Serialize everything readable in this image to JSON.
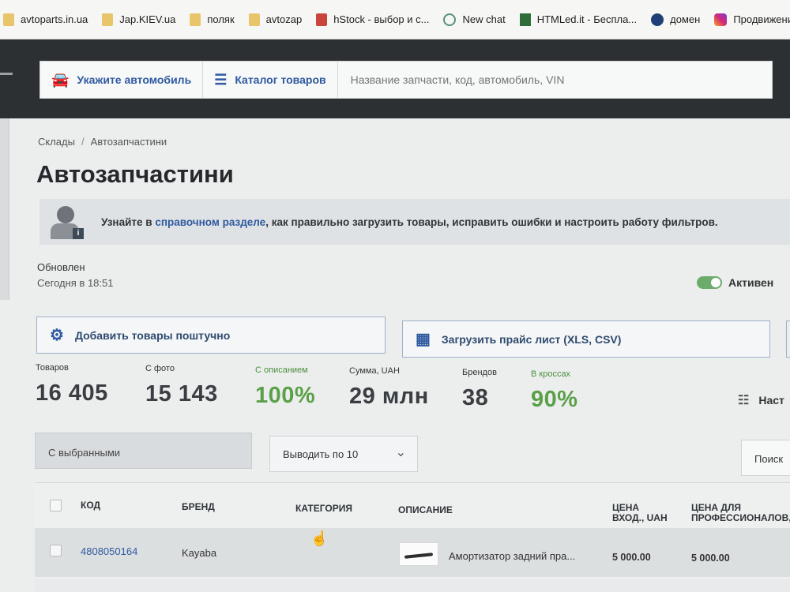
{
  "bookmarks": [
    {
      "label": "avtoparts.in.ua",
      "icon": "folder-icon"
    },
    {
      "label": "Jap.KIEV.ua",
      "icon": "folder-icon"
    },
    {
      "label": "поляк",
      "icon": "folder-icon"
    },
    {
      "label": "avtozap",
      "icon": "folder-icon"
    },
    {
      "label": "hStock - выбор и с...",
      "icon": "cart-icon"
    },
    {
      "label": "New chat",
      "icon": "chatgpt-icon"
    },
    {
      "label": "HTMLed.it - Беспла...",
      "icon": "htmled-icon"
    },
    {
      "label": "домен",
      "icon": "globe-icon"
    },
    {
      "label": "Продвижение",
      "icon": "instagram-icon"
    }
  ],
  "header": {
    "car_button": "Укажите автомобиль",
    "catalog_button": "Каталог товаров",
    "search_placeholder": "Название запчасти, код, автомобиль, VIN"
  },
  "breadcrumb": {
    "parent": "Склады",
    "separator": "/",
    "current": "Автозапчастини"
  },
  "page_title": "Автозапчастини",
  "help": {
    "prefix": "Узнайте в ",
    "link": "справочном разделе",
    "suffix": ", как правильно загрузить товары, исправить ошибки и настроить работу фильтров."
  },
  "status": {
    "updated_label": "Обновлен",
    "updated_value": "Сегодня в 18:51",
    "active_label": "Активен",
    "active": true
  },
  "actions": {
    "add_items": "Добавить товары поштучно",
    "upload_price": "Загрузить прайс лист (XLS, CSV)"
  },
  "stats": [
    {
      "label": "Товаров",
      "value": "16 405"
    },
    {
      "label": "С фото",
      "value": "15 143"
    },
    {
      "label": "С описанием",
      "value": "100%"
    },
    {
      "label": "Сумма, UAH",
      "value": "29 млн"
    },
    {
      "label": "Брендов",
      "value": "38"
    },
    {
      "label": "В кроссах",
      "value": "90%"
    }
  ],
  "settings_label": "Наст",
  "toolbar": {
    "bulk_label": "С выбранными",
    "per_page": "Выводить по 10",
    "search_button": "Поиск"
  },
  "table": {
    "headers": {
      "code": "КОД",
      "brand": "БРЕНД",
      "category": "КАТЕГОРИЯ",
      "description": "ОПИСАНИЕ",
      "price_in_1": "ЦЕНА",
      "price_in_2": "ВХОД., UAH",
      "price_pro_1": "ЦЕНА  ДЛЯ",
      "price_pro_2": "ПРОФЕССИОНАЛОВ,"
    },
    "rows": [
      {
        "code": "4808050164",
        "brand": "Kayaba",
        "category": "",
        "description": "Амортизатор задний пра...",
        "price_in": "5 000.00",
        "price_pro": "5 000.00"
      }
    ]
  },
  "colors": {
    "header_bg": "#2d3033",
    "link_blue": "#2f5aa0",
    "accent_green": "#5aa048"
  }
}
